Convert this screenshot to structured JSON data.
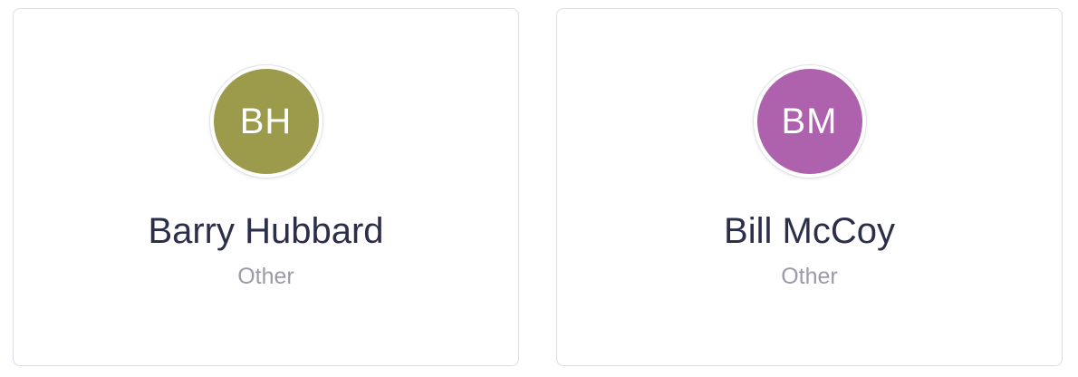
{
  "contacts": [
    {
      "initials": "BH",
      "name": "Barry Hubbard",
      "role": "Other",
      "avatar_color": "#9c9a4b"
    },
    {
      "initials": "BM",
      "name": "Bill McCoy",
      "role": "Other",
      "avatar_color": "#ae61ac"
    }
  ]
}
